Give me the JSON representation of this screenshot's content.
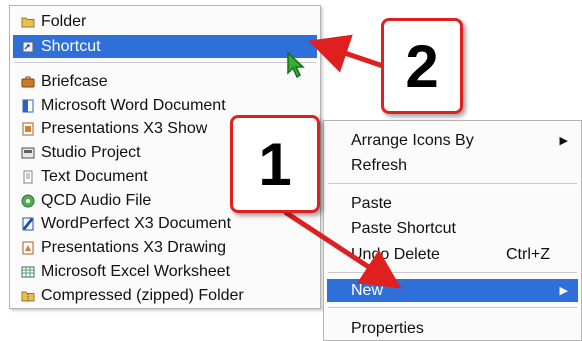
{
  "submenu": {
    "items": [
      {
        "label": "Folder",
        "icon": "folder-icon",
        "color": "#e0b030"
      },
      {
        "label": "Shortcut",
        "icon": "shortcut-icon",
        "color": "#e8e8e8",
        "highlighted": true
      },
      {
        "label": "Briefcase",
        "icon": "briefcase-icon",
        "color": "#c07020"
      },
      {
        "label": "Microsoft Word Document",
        "icon": "word-document-icon",
        "color": "#3060c0"
      },
      {
        "label": "Presentations X3 Show",
        "icon": "presentations-show-icon",
        "color": "#d08030"
      },
      {
        "label": "Studio Project",
        "icon": "studio-project-icon",
        "color": "#606060"
      },
      {
        "label": "Text Document",
        "icon": "text-document-icon",
        "color": "#9090a0"
      },
      {
        "label": "QCD Audio File",
        "icon": "audio-file-icon",
        "color": "#40a040"
      },
      {
        "label": "WordPerfect X3 Document",
        "icon": "wordperfect-document-icon",
        "color": "#2050b0"
      },
      {
        "label": "Presentations X3 Drawing",
        "icon": "presentations-drawing-icon",
        "color": "#d08030"
      },
      {
        "label": "Microsoft Excel Worksheet",
        "icon": "excel-worksheet-icon",
        "color": "#308050"
      },
      {
        "label": "Compressed (zipped) Folder",
        "icon": "zip-folder-icon",
        "color": "#d0a020"
      }
    ]
  },
  "context_menu": {
    "items": [
      {
        "label": "Arrange Icons By",
        "has_submenu": true
      },
      {
        "label": "Refresh"
      },
      {
        "label": "Paste"
      },
      {
        "label": "Paste Shortcut"
      },
      {
        "label": "Undo Delete",
        "shortcut": "Ctrl+Z"
      },
      {
        "label": "New",
        "has_submenu": true,
        "highlighted": true
      },
      {
        "label": "Properties"
      }
    ],
    "submenu_arrow": "▶"
  },
  "callouts": {
    "one": "1",
    "two": "2"
  },
  "colors": {
    "highlight": "#2f6fd8",
    "callout_border": "#e02020",
    "arrow": "#e02020",
    "cursor": "#30b030"
  }
}
